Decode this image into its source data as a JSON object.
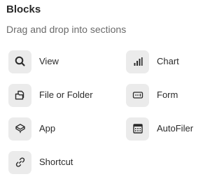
{
  "panel": {
    "title": "Blocks",
    "subtitle": "Drag and drop into sections"
  },
  "blocks": {
    "view": {
      "label": "View",
      "icon": "search-icon"
    },
    "file": {
      "label": "File or Folder",
      "icon": "file-folder-icon"
    },
    "app": {
      "label": "App",
      "icon": "app-layers-icon"
    },
    "shortcut": {
      "label": "Shortcut",
      "icon": "link-icon"
    },
    "chart": {
      "label": "Chart",
      "icon": "bar-chart-icon"
    },
    "form": {
      "label": "Form",
      "icon": "form-icon"
    },
    "autofiler": {
      "label": "AutoFiler",
      "icon": "calendar-grid-icon"
    }
  },
  "colors": {
    "icon_tile_bg": "#ebebeb",
    "icon_stroke": "#2b2b2b",
    "subtitle": "#6b6b6b"
  }
}
